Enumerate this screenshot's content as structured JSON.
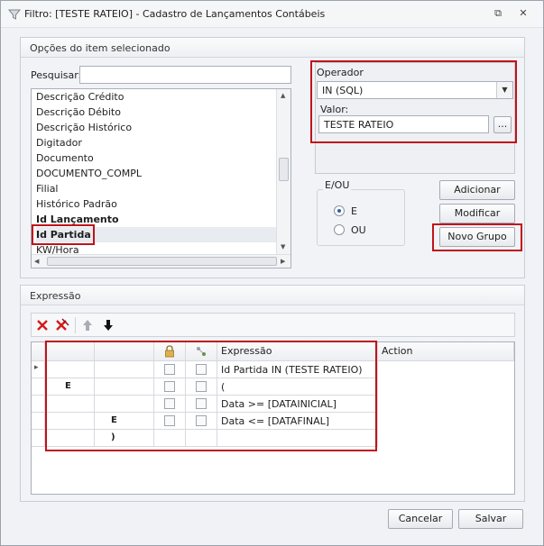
{
  "window": {
    "title": "Filtro: [TESTE RATEIO] - Cadastro de Lançamentos Contábeis",
    "restore_glyph": "⧉",
    "close_glyph": "✕"
  },
  "options": {
    "header": "Opções do item selecionado",
    "search_label": "Pesquisar:",
    "search_value": "",
    "items": [
      {
        "label": "Descrição Crédito",
        "bold": false
      },
      {
        "label": "Descrição Débito",
        "bold": false
      },
      {
        "label": "Descrição Histórico",
        "bold": false
      },
      {
        "label": "Digitador",
        "bold": false
      },
      {
        "label": "Documento",
        "bold": false
      },
      {
        "label": "DOCUMENTO_COMPL",
        "bold": false
      },
      {
        "label": "Filial",
        "bold": false
      },
      {
        "label": "Histórico Padrão",
        "bold": false
      },
      {
        "label": "Id Lançamento",
        "bold": true
      },
      {
        "label": "Id Partida",
        "bold": true,
        "selected": true
      },
      {
        "label": "KW/Hora",
        "bold": false
      }
    ],
    "operator_label": "Operador",
    "operator_value": "IN (SQL)",
    "value_label": "Valor:",
    "value_value": "TESTE RATEIO",
    "ellipsis": "...",
    "eou_label": "E/OU",
    "radio_e": "E",
    "radio_ou": "OU",
    "btn_add": "Adicionar",
    "btn_modify": "Modificar",
    "btn_new_group": "Novo Grupo"
  },
  "expression": {
    "header": "Expressão",
    "col_expr": "Expressão",
    "col_action": "Action",
    "rows": [
      {
        "op1": "",
        "op2": "",
        "text": "Id Partida IN (TESTE RATEIO)"
      },
      {
        "op1": "E",
        "op2": "",
        "text": "("
      },
      {
        "op1": "",
        "op2": "",
        "text": "Data >= [DATAINICIAL]"
      },
      {
        "op1": "",
        "op2": "E",
        "text": "Data <= [DATAFINAL]"
      },
      {
        "op1": "",
        "op2": ")",
        "text": ""
      }
    ]
  },
  "footer": {
    "cancel": "Cancelar",
    "save": "Salvar"
  },
  "colors": {
    "accent": "#c0131b",
    "delete": "#d41a1a"
  }
}
